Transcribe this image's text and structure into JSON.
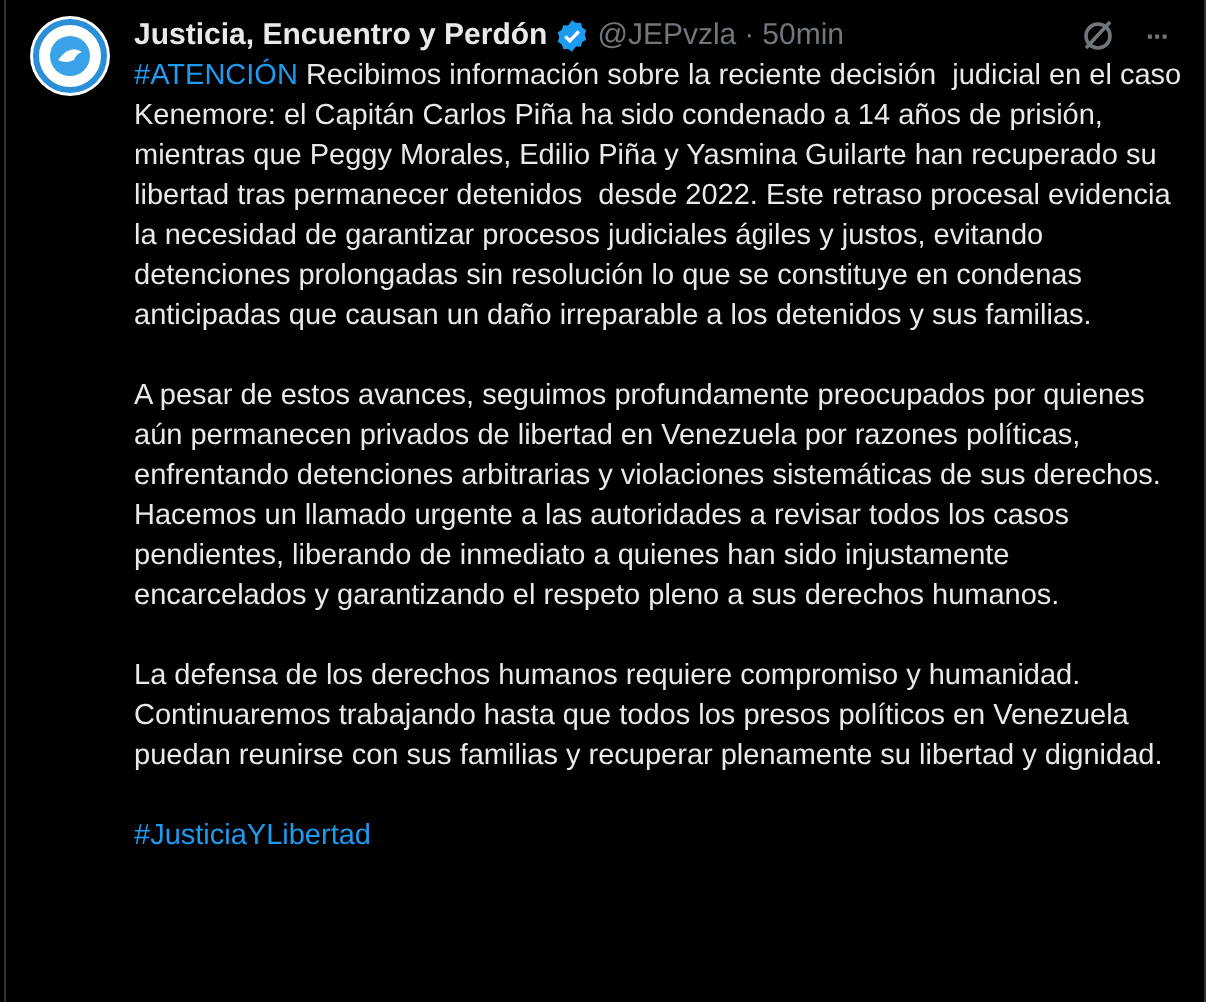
{
  "post": {
    "author": "Justicia, Encuentro y Perdón",
    "verified": true,
    "handle": "@JEPvzla",
    "separator": "·",
    "time": "50min",
    "more": "···",
    "paragraphs": [
      {
        "hashtag": "#ATENCIÓN",
        "text": "Recibimos información sobre la reciente decisión  judicial en el caso Kenemore: el Capitán Carlos Piña ha sido condenado a 14 años de prisión, mientras que Peggy Morales, Edilio Piña y Yasmina Guilarte han recuperado su libertad tras permanecer detenidos  desde 2022. Este retraso procesal evidencia la necesidad de garantizar procesos judiciales ágiles y justos, evitando detenciones prolongadas sin resolución lo que se constituye en condenas anticipadas que causan un daño irreparable a los detenidos y sus familias."
      },
      {
        "text": "A pesar de estos avances, seguimos profundamente preocupados por quienes aún permanecen privados de libertad en Venezuela por razones políticas, enfrentando detenciones arbitrarias y violaciones sistemáticas de sus derechos. Hacemos un llamado urgente a las autoridades a revisar todos los casos pendientes, liberando de inmediato a quienes han sido injustamente encarcelados y garantizando el respeto pleno a sus derechos humanos."
      },
      {
        "text": "La defensa de los derechos humanos requiere compromiso y humanidad. Continuaremos trabajando hasta que todos los presos políticos en Venezuela puedan reunirse con sus familias y recuperar plenamente su libertad y dignidad."
      },
      {
        "hashtag": "#JusticiaYLibertad"
      }
    ]
  }
}
